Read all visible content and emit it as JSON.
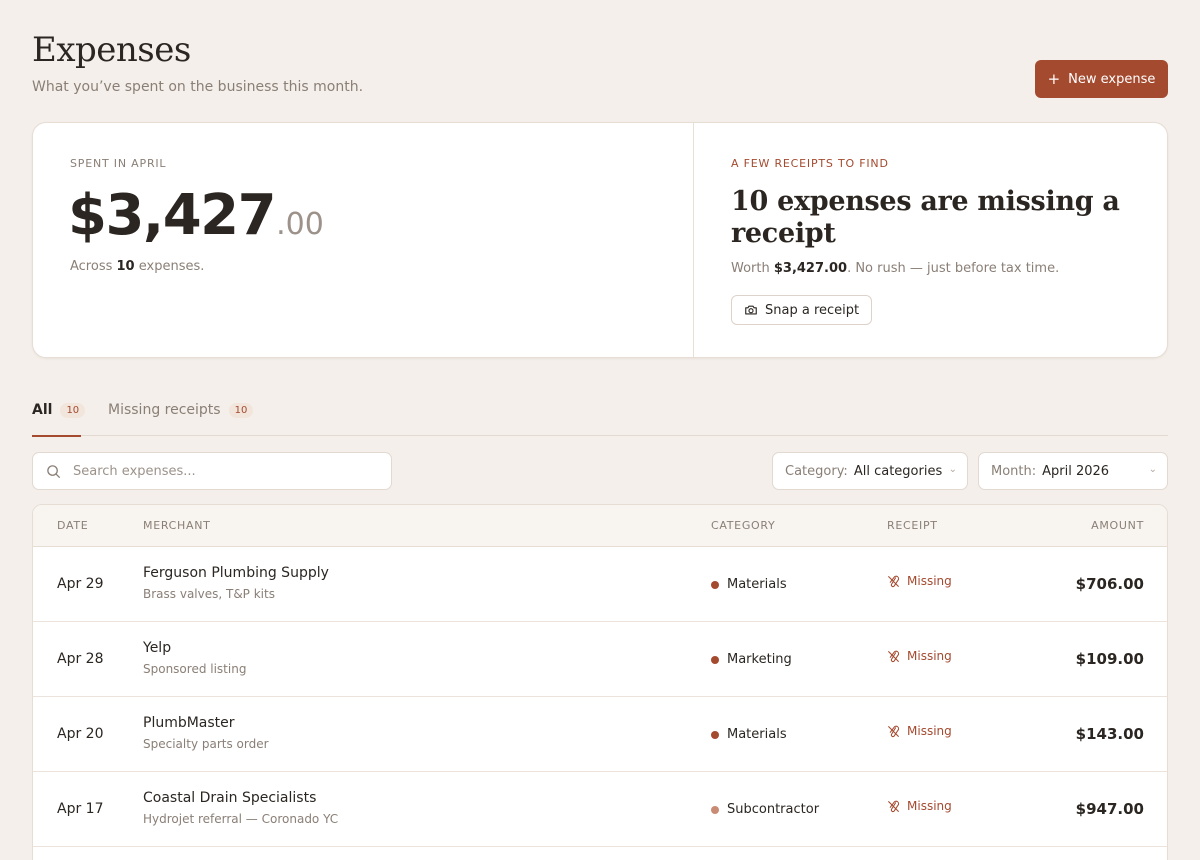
{
  "header": {
    "title": "Expenses",
    "subtitle": "What you’ve spent on the business this month.",
    "new_expense_label": "New expense"
  },
  "summary": {
    "spent_eyebrow": "SPENT IN APRIL",
    "spent_dollars": "$3,427",
    "spent_cents": ".00",
    "caption_prefix": "Across ",
    "caption_count": "10",
    "caption_suffix": " expenses.",
    "missing_eyebrow": "A FEW RECEIPTS TO FIND",
    "missing_title": "10 expenses are missing a receipt",
    "missing_caption_prefix": "Worth ",
    "missing_amount": "$3,427.00",
    "missing_caption_suffix": ". No rush — just before tax time.",
    "snap_label": "Snap a receipt"
  },
  "tabs": [
    {
      "label": "All",
      "count": "10"
    },
    {
      "label": "Missing receipts",
      "count": "10"
    }
  ],
  "filters": {
    "search_placeholder": "Search expenses...",
    "category_label": "Category:",
    "category_value": "All categories",
    "month_label": "Month:",
    "month_value": "April 2026"
  },
  "table": {
    "headers": {
      "date": "DATE",
      "merchant": "MERCHANT",
      "category": "CATEGORY",
      "receipt": "RECEIPT",
      "amount": "AMOUNT"
    },
    "rows": [
      {
        "date": "Apr 29",
        "merchant": "Ferguson Plumbing Supply",
        "note": "Brass valves, T&P kits",
        "category": "Materials",
        "receipt": "Missing",
        "amount": "$706.00"
      },
      {
        "date": "Apr 28",
        "merchant": "Yelp",
        "note": "Sponsored listing",
        "category": "Marketing",
        "receipt": "Missing",
        "amount": "$109.00"
      },
      {
        "date": "Apr 20",
        "merchant": "PlumbMaster",
        "note": "Specialty parts order",
        "category": "Materials",
        "receipt": "Missing",
        "amount": "$143.00"
      },
      {
        "date": "Apr 17",
        "merchant": "Coastal Drain Specialists",
        "note": "Hydrojet referral — Coronado YC",
        "category": "Subcontractor",
        "receipt": "Missing",
        "amount": "$947.00"
      }
    ]
  },
  "colors": {
    "accent": "#a44a2f",
    "category_materials": "#a44a2f",
    "category_marketing": "#a44a2f",
    "category_subcontractor": "#c98b74"
  },
  "icons": {
    "new_expense": "plus-icon",
    "snap": "camera-icon",
    "search": "search-icon",
    "receipt_missing": "receipt-off-icon",
    "select": "chevron-down-icon"
  }
}
